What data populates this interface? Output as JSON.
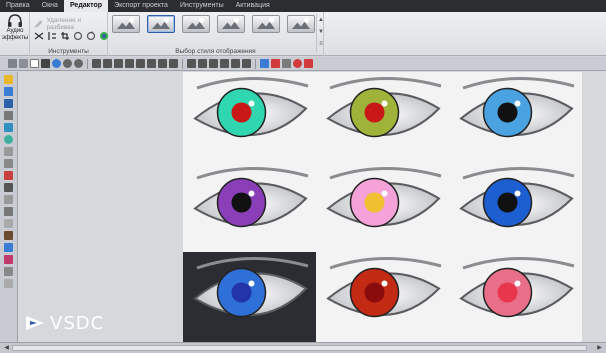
{
  "menu": {
    "tabs": [
      "Правка",
      "Окна",
      "Редактор",
      "Экспорт проекта",
      "Инструменты",
      "Активация"
    ],
    "active_index": 2
  },
  "ribbon": {
    "audio_button_label_line1": "Аудио",
    "audio_button_label_line2": "эффекты",
    "disabled_action": "Удаление и разбивка",
    "tools_group_label": "Инструменты",
    "styles_group_label": "Выбор стиля отображения",
    "style_count": 6,
    "selected_style_index": 1
  },
  "brand": {
    "name": "VSDC",
    "accent": "#2f5fa8"
  },
  "eyes": {
    "iris_colors": [
      "#2fd6b0",
      "#9fb33a",
      "#4aa3e0",
      "#8a3fb8",
      "#f4a2d8",
      "#1d5fd0",
      "#2f6fd8",
      "#c22a14",
      "#e86f87"
    ],
    "pupil_colors": [
      "#c81818",
      "#c81818",
      "#111111",
      "#111111",
      "#f0c030",
      "#111111",
      "#2333a8",
      "#8a0c0c",
      "#e8364d"
    ]
  }
}
